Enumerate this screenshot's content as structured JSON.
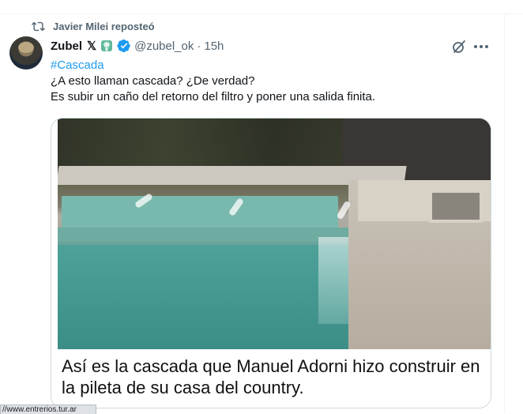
{
  "repost": {
    "icon": "repost-icon",
    "text": "Javier Milei reposteó"
  },
  "tweet": {
    "display_name": "Zubel",
    "badges": [
      "x-badge",
      "statue-of-liberty-emoji",
      "verified-badge"
    ],
    "x_badge_text": "𝕏",
    "handle": "@zubel_ok",
    "separator": "·",
    "time": "15h",
    "hashtag": "#Cascada",
    "lines": [
      "¿A esto llaman cascada? ¿De verdad?",
      "Es subir un caño del retorno del filtro y poner una salida finita."
    ],
    "media": {
      "image": "swimming-pool-with-small-waterfalls",
      "caption": "Así es la cascada que Manuel Adorni hizo construir en la pileta de su casa del country."
    }
  },
  "actions": {
    "grok": "grok-icon",
    "more": "more-icon"
  },
  "status_bar": {
    "url": "//www.entrerios.tur.ar"
  },
  "colors": {
    "accent": "#1d9bf0",
    "secondary_text": "#536471",
    "border": "#cfd9de",
    "verified": "#1d9bf0"
  }
}
